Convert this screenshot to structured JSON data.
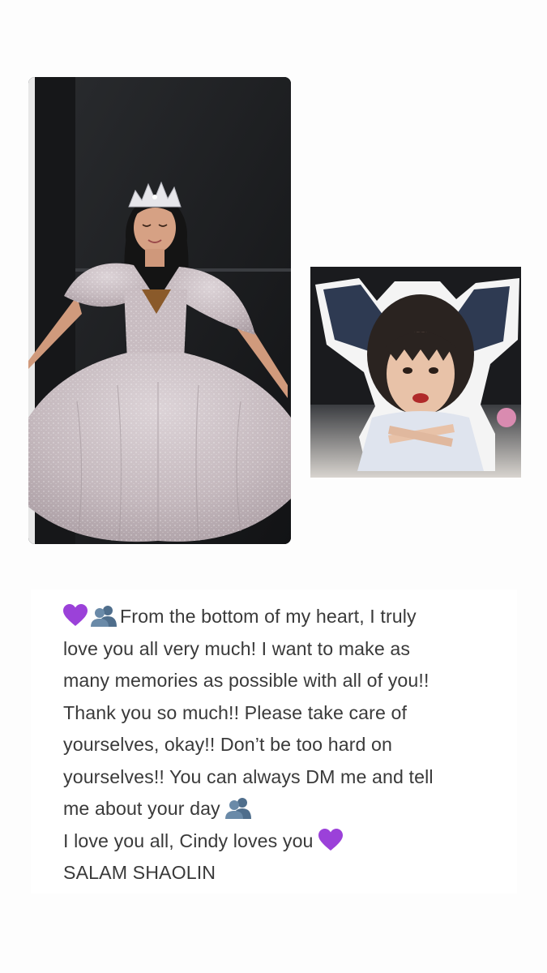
{
  "story": {
    "main_photo": {
      "alt": "Girl in a sparkling lilac ball gown wearing a tiara"
    },
    "sticker_photo": {
      "alt": "Cut-out sticker photo of a child with bangs and crossed hands"
    },
    "caption": {
      "lines": [
        {
          "prefix_icons": [
            "purple-heart",
            "two-silhouettes"
          ],
          "text": "From the bottom of my heart, I truly"
        },
        {
          "text": "love you all very much! I want to make as"
        },
        {
          "text": "many memories as possible with all of you!!"
        },
        {
          "text": "Thank you so much!! Please take care of"
        },
        {
          "text": "yourselves, okay!! Don’t be too hard on"
        },
        {
          "text": "yourselves!! You can always DM me and tell"
        },
        {
          "text": "me about your day",
          "suffix_icon": "two-silhouettes"
        },
        {
          "text": "I love you all, Cindy loves you",
          "suffix_icon": "purple-heart"
        },
        {
          "text": "SALAM SHAOLIN"
        }
      ]
    }
  },
  "colors": {
    "text": "#3a3a3a",
    "heart": "#9b41d9",
    "silhouette": "#5a7a9a",
    "gown": "#c9bcc2"
  }
}
